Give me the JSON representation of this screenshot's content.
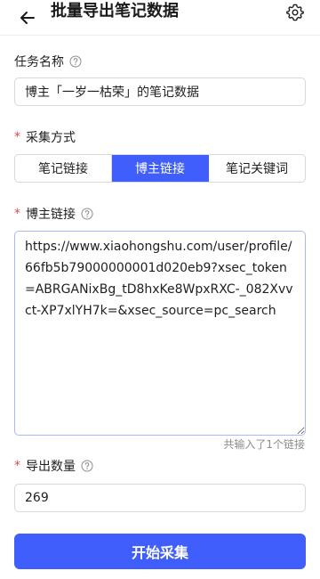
{
  "header": {
    "back_icon": "arrow-left-icon",
    "title": "批量导出笔记数据",
    "settings_icon": "gear-icon"
  },
  "task_name": {
    "label": "任务名称",
    "help_icon": "question-circle-icon",
    "value": "博主「一岁一枯荣」的笔记数据"
  },
  "collect_method": {
    "required_mark": "*",
    "label": "采集方式",
    "options": [
      "笔记链接",
      "博主链接",
      "笔记关键词"
    ],
    "selected": "博主链接"
  },
  "blogger_link": {
    "required_mark": "*",
    "label": "博主链接",
    "help_icon": "question-circle-icon",
    "value": "https://www.xiaohongshu.com/user/profile/66fb5b79000000001d020eb9?xsec_token=ABRGANixBg_tD8hxKe8WpxRXC-_082Xvvct-XP7xlYH7k=&xsec_source=pc_search",
    "counter": "共输入了1个链接"
  },
  "export_count": {
    "required_mark": "*",
    "label": "导出数量",
    "help_icon": "question-circle-icon",
    "value": "269"
  },
  "start_button": {
    "label": "开始采集"
  },
  "colors": {
    "accent": "#3f5efb",
    "required": "#e5484d",
    "border": "#d9d9d9",
    "muted": "#8c8c8c"
  }
}
